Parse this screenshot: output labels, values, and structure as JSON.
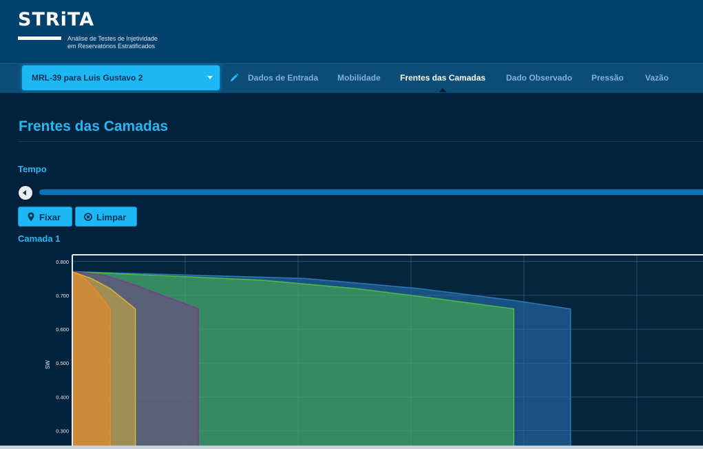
{
  "header": {
    "logo": "STRiTA",
    "subtitle_line1": "Análise de Testes de Injetividade",
    "subtitle_line2": "em Reservatórios Estratificados"
  },
  "nav": {
    "project": "MRL-39 para Luis Gustavo 2",
    "tabs": [
      {
        "label": "Dados de Entrada",
        "active": false
      },
      {
        "label": "Mobilidade",
        "active": false
      },
      {
        "label": "Frentes das Camadas",
        "active": true
      },
      {
        "label": "Dado Observado",
        "active": false
      },
      {
        "label": "Pressão",
        "active": false
      },
      {
        "label": "Vazão",
        "active": false
      }
    ]
  },
  "main": {
    "title": "Frentes das Camadas",
    "tempo_label": "Tempo",
    "slider_value": 0,
    "fixar_label": "Fixar",
    "limpar_label": "Limpar",
    "camada_label": "Camada 1"
  },
  "colors": {
    "accent": "#29b6f6",
    "button": "#1cb8f5",
    "header_bg": "#02416b",
    "nav_bg": "#0c4d78",
    "page_bg": "#00223a",
    "plot_bg": "#05253d"
  },
  "chart_data": {
    "type": "area",
    "title": "",
    "xlabel": "",
    "ylabel": "SW",
    "ylim": [
      0.25,
      0.82
    ],
    "y_ticks": [
      "0.800",
      "0.700",
      "0.600",
      "0.500",
      "0.400",
      "0.300"
    ],
    "x_unit_note": "x axis ticks not visible",
    "xlim": [
      0,
      100
    ],
    "series": [
      {
        "color": "#2a78b8",
        "points": [
          [
            0,
            0.77
          ],
          [
            37,
            0.75
          ],
          [
            55,
            0.72
          ],
          [
            70,
            0.685
          ],
          [
            79,
            0.66
          ],
          [
            79,
            0.2
          ],
          [
            0,
            0.2
          ]
        ]
      },
      {
        "color": "#4db848",
        "points": [
          [
            0,
            0.77
          ],
          [
            30,
            0.745
          ],
          [
            45,
            0.72
          ],
          [
            58,
            0.69
          ],
          [
            70,
            0.66
          ],
          [
            70,
            0.2
          ],
          [
            0,
            0.2
          ]
        ]
      },
      {
        "color": "#7a3e8c",
        "points": [
          [
            0,
            0.77
          ],
          [
            5,
            0.76
          ],
          [
            10,
            0.73
          ],
          [
            20,
            0.66
          ],
          [
            20,
            0.2
          ],
          [
            0,
            0.2
          ]
        ]
      },
      {
        "color": "#d9b33b",
        "points": [
          [
            0,
            0.77
          ],
          [
            3,
            0.75
          ],
          [
            6,
            0.72
          ],
          [
            10,
            0.66
          ],
          [
            10,
            0.2
          ],
          [
            0,
            0.2
          ]
        ]
      },
      {
        "color": "#f08a24",
        "points": [
          [
            0,
            0.77
          ],
          [
            2,
            0.75
          ],
          [
            4,
            0.71
          ],
          [
            6,
            0.66
          ],
          [
            6,
            0.2
          ],
          [
            0,
            0.2
          ]
        ]
      }
    ]
  }
}
